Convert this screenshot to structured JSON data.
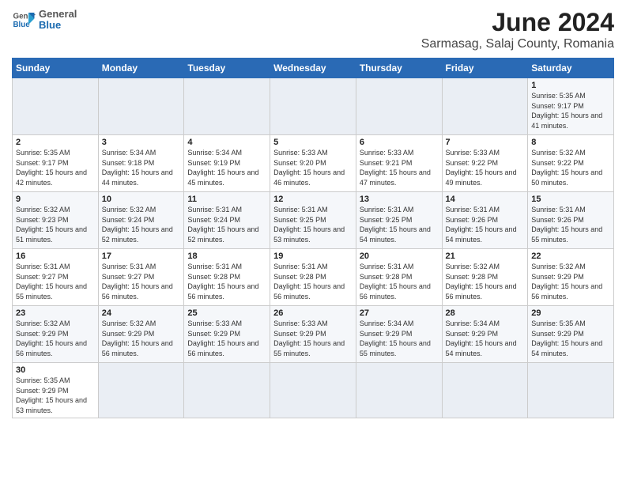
{
  "header": {
    "logo": {
      "general": "General",
      "blue": "Blue"
    },
    "title": "June 2024",
    "location": "Sarmasag, Salaj County, Romania"
  },
  "days_of_week": [
    "Sunday",
    "Monday",
    "Tuesday",
    "Wednesday",
    "Thursday",
    "Friday",
    "Saturday"
  ],
  "weeks": [
    [
      {
        "day": "",
        "info": ""
      },
      {
        "day": "",
        "info": ""
      },
      {
        "day": "",
        "info": ""
      },
      {
        "day": "",
        "info": ""
      },
      {
        "day": "",
        "info": ""
      },
      {
        "day": "",
        "info": ""
      },
      {
        "day": "1",
        "info": "Sunrise: 5:35 AM\nSunset: 9:17 PM\nDaylight: 15 hours\nand 41 minutes."
      }
    ],
    [
      {
        "day": "2",
        "info": "Sunrise: 5:35 AM\nSunset: 9:17 PM\nDaylight: 15 hours\nand 42 minutes."
      },
      {
        "day": "3",
        "info": "Sunrise: 5:34 AM\nSunset: 9:18 PM\nDaylight: 15 hours\nand 44 minutes."
      },
      {
        "day": "4",
        "info": "Sunrise: 5:34 AM\nSunset: 9:19 PM\nDaylight: 15 hours\nand 45 minutes."
      },
      {
        "day": "5",
        "info": "Sunrise: 5:33 AM\nSunset: 9:20 PM\nDaylight: 15 hours\nand 46 minutes."
      },
      {
        "day": "6",
        "info": "Sunrise: 5:33 AM\nSunset: 9:21 PM\nDaylight: 15 hours\nand 47 minutes."
      },
      {
        "day": "7",
        "info": "Sunrise: 5:33 AM\nSunset: 9:22 PM\nDaylight: 15 hours\nand 49 minutes."
      },
      {
        "day": "8",
        "info": "Sunrise: 5:32 AM\nSunset: 9:22 PM\nDaylight: 15 hours\nand 50 minutes."
      }
    ],
    [
      {
        "day": "9",
        "info": "Sunrise: 5:32 AM\nSunset: 9:23 PM\nDaylight: 15 hours\nand 51 minutes."
      },
      {
        "day": "10",
        "info": "Sunrise: 5:32 AM\nSunset: 9:24 PM\nDaylight: 15 hours\nand 52 minutes."
      },
      {
        "day": "11",
        "info": "Sunrise: 5:31 AM\nSunset: 9:24 PM\nDaylight: 15 hours\nand 52 minutes."
      },
      {
        "day": "12",
        "info": "Sunrise: 5:31 AM\nSunset: 9:25 PM\nDaylight: 15 hours\nand 53 minutes."
      },
      {
        "day": "13",
        "info": "Sunrise: 5:31 AM\nSunset: 9:25 PM\nDaylight: 15 hours\nand 54 minutes."
      },
      {
        "day": "14",
        "info": "Sunrise: 5:31 AM\nSunset: 9:26 PM\nDaylight: 15 hours\nand 54 minutes."
      },
      {
        "day": "15",
        "info": "Sunrise: 5:31 AM\nSunset: 9:26 PM\nDaylight: 15 hours\nand 55 minutes."
      }
    ],
    [
      {
        "day": "16",
        "info": "Sunrise: 5:31 AM\nSunset: 9:27 PM\nDaylight: 15 hours\nand 55 minutes."
      },
      {
        "day": "17",
        "info": "Sunrise: 5:31 AM\nSunset: 9:27 PM\nDaylight: 15 hours\nand 56 minutes."
      },
      {
        "day": "18",
        "info": "Sunrise: 5:31 AM\nSunset: 9:28 PM\nDaylight: 15 hours\nand 56 minutes."
      },
      {
        "day": "19",
        "info": "Sunrise: 5:31 AM\nSunset: 9:28 PM\nDaylight: 15 hours\nand 56 minutes."
      },
      {
        "day": "20",
        "info": "Sunrise: 5:31 AM\nSunset: 9:28 PM\nDaylight: 15 hours\nand 56 minutes."
      },
      {
        "day": "21",
        "info": "Sunrise: 5:32 AM\nSunset: 9:28 PM\nDaylight: 15 hours\nand 56 minutes."
      },
      {
        "day": "22",
        "info": "Sunrise: 5:32 AM\nSunset: 9:29 PM\nDaylight: 15 hours\nand 56 minutes."
      }
    ],
    [
      {
        "day": "23",
        "info": "Sunrise: 5:32 AM\nSunset: 9:29 PM\nDaylight: 15 hours\nand 56 minutes."
      },
      {
        "day": "24",
        "info": "Sunrise: 5:32 AM\nSunset: 9:29 PM\nDaylight: 15 hours\nand 56 minutes."
      },
      {
        "day": "25",
        "info": "Sunrise: 5:33 AM\nSunset: 9:29 PM\nDaylight: 15 hours\nand 56 minutes."
      },
      {
        "day": "26",
        "info": "Sunrise: 5:33 AM\nSunset: 9:29 PM\nDaylight: 15 hours\nand 55 minutes."
      },
      {
        "day": "27",
        "info": "Sunrise: 5:34 AM\nSunset: 9:29 PM\nDaylight: 15 hours\nand 55 minutes."
      },
      {
        "day": "28",
        "info": "Sunrise: 5:34 AM\nSunset: 9:29 PM\nDaylight: 15 hours\nand 54 minutes."
      },
      {
        "day": "29",
        "info": "Sunrise: 5:35 AM\nSunset: 9:29 PM\nDaylight: 15 hours\nand 54 minutes."
      }
    ],
    [
      {
        "day": "30",
        "info": "Sunrise: 5:35 AM\nSunset: 9:29 PM\nDaylight: 15 hours\nand 53 minutes."
      },
      {
        "day": "",
        "info": ""
      },
      {
        "day": "",
        "info": ""
      },
      {
        "day": "",
        "info": ""
      },
      {
        "day": "",
        "info": ""
      },
      {
        "day": "",
        "info": ""
      },
      {
        "day": "",
        "info": ""
      }
    ]
  ]
}
